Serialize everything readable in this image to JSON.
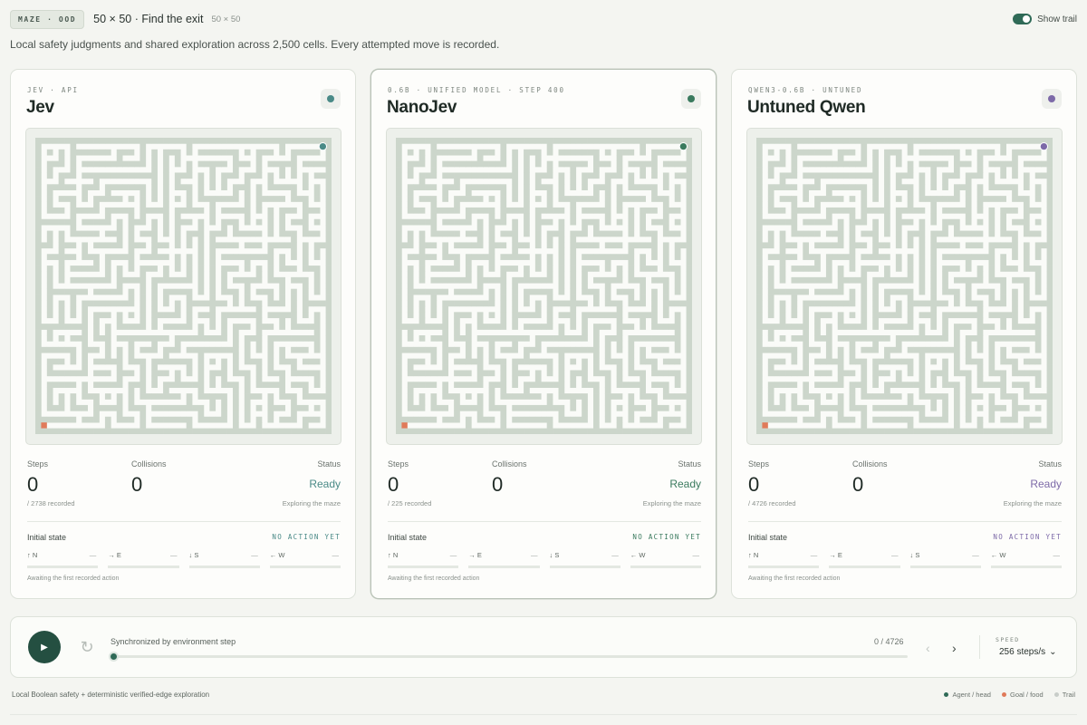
{
  "header": {
    "badge": "MAZE · OOD",
    "title": "50 × 50 · Find the exit",
    "size": "50 × 50",
    "toggle_label": "Show trail",
    "description": "Local safety judgments and shared exploration across 2,500 cells. Every attempted move is recorded."
  },
  "colors": {
    "wall": "#ccd6cb",
    "floor": "#fafbf8",
    "goal": "#e07a5a",
    "accent": "#2f6a57",
    "trail": "#c8cdc9"
  },
  "panels": [
    {
      "eyebrow": "JEV · API",
      "name": "Jev",
      "color": "#4a8a87",
      "steps_label": "Steps",
      "steps": "0",
      "recorded": "/ 2738 recorded",
      "collisions_label": "Collisions",
      "collisions": "0",
      "status_label": "Status",
      "status": "Ready",
      "status_sub": "Exploring the maze",
      "initial_label": "Initial state",
      "no_action": "NO ACTION YET",
      "directions": [
        {
          "label": "↑ N",
          "value": "—"
        },
        {
          "label": "→ E",
          "value": "—"
        },
        {
          "label": "↓ S",
          "value": "—"
        },
        {
          "label": "← W",
          "value": "—"
        }
      ],
      "awaiting": "Awaiting the first recorded action"
    },
    {
      "eyebrow": "0.6B · UNIFIED MODEL · STEP 400",
      "name": "NanoJev",
      "color": "#3a7a5e",
      "steps_label": "Steps",
      "steps": "0",
      "recorded": "/ 225 recorded",
      "collisions_label": "Collisions",
      "collisions": "0",
      "status_label": "Status",
      "status": "Ready",
      "status_sub": "Exploring the maze",
      "initial_label": "Initial state",
      "no_action": "NO ACTION YET",
      "directions": [
        {
          "label": "↑ N",
          "value": "—"
        },
        {
          "label": "→ E",
          "value": "—"
        },
        {
          "label": "↓ S",
          "value": "—"
        },
        {
          "label": "← W",
          "value": "—"
        }
      ],
      "awaiting": "Awaiting the first recorded action"
    },
    {
      "eyebrow": "QWEN3-0.6B · UNTUNED",
      "name": "Untuned Qwen",
      "color": "#7d6aa8",
      "steps_label": "Steps",
      "steps": "0",
      "recorded": "/ 4726 recorded",
      "collisions_label": "Collisions",
      "collisions": "0",
      "status_label": "Status",
      "status": "Ready",
      "status_sub": "Exploring the maze",
      "initial_label": "Initial state",
      "no_action": "NO ACTION YET",
      "directions": [
        {
          "label": "↑ N",
          "value": "—"
        },
        {
          "label": "→ E",
          "value": "—"
        },
        {
          "label": "↓ S",
          "value": "—"
        },
        {
          "label": "← W",
          "value": "—"
        }
      ],
      "awaiting": "Awaiting the first recorded action"
    }
  ],
  "controls": {
    "play_icon": "play-icon",
    "sync_label": "Synchronized by environment step",
    "step_readout": "0 / 4726",
    "progress": 0,
    "speed_label": "SPEED",
    "speed_value": "256 steps/s"
  },
  "footer": {
    "left": "Local Boolean safety + deterministic verified-edge exploration",
    "legend": [
      {
        "label": "Agent / head",
        "color": "#2f6a57"
      },
      {
        "label": "Goal / food",
        "color": "#e07a5a"
      },
      {
        "label": "Trail",
        "color": "#c8cdc9"
      }
    ]
  }
}
